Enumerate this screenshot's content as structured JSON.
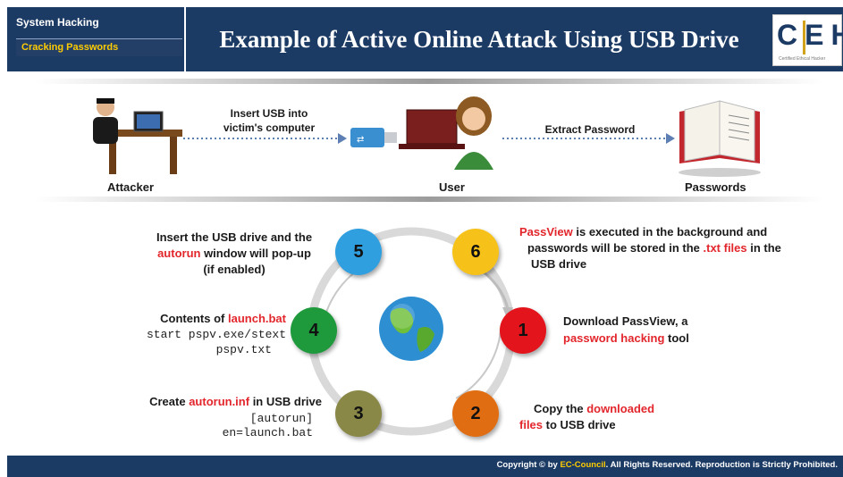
{
  "header": {
    "section": "System Hacking",
    "subsection": "Cracking Passwords",
    "title": "Example of Active Online Attack Using USB Drive",
    "logo": "CEH",
    "logo_small": "Certified Ethical Hacker"
  },
  "flow": {
    "attacker": "Attacker",
    "user": "User",
    "passwords": "Passwords",
    "step_a_line1": "Insert USB into",
    "step_a_line2": "victim's computer",
    "step_b": "Extract Password"
  },
  "cycle": {
    "nums": [
      "1",
      "2",
      "3",
      "4",
      "5",
      "6"
    ],
    "s1_line1": "Download PassView, a",
    "s1_red": "password hacking",
    "s1_rest": " tool",
    "s2_pre": "Copy  the ",
    "s2_red1": "downloaded",
    "s2_red2": "files",
    "s2_rest": " to USB drive",
    "s3_pre": "Create ",
    "s3_red": "autorun.inf",
    "s3_rest": " in USB drive",
    "s3_code1": "[autorun]",
    "s3_code2": "en=launch.bat",
    "s4_pre": "Contents of ",
    "s4_red": "launch.bat",
    "s4_code1": "start pspv.exe/stext",
    "s4_code2": "pspv.txt",
    "s5_line1": "Insert the USB drive and the",
    "s5_red": "autorun",
    "s5_rest": " window will pop-up",
    "s5_line3": "(if enabled)",
    "s6_red1": "PassView",
    "s6_rest1": " is executed in the background and",
    "s6_pre2": "passwords will be stored in the ",
    "s6_red2": ".txt files",
    "s6_rest2": " in the",
    "s6_line3": "USB drive"
  },
  "footer": {
    "pre": "Copyright © by ",
    "brand": "EC-Council",
    "rest": ". All Rights Reserved. Reproduction is Strictly Prohibited."
  },
  "colors": {
    "navy": "#1b3a64",
    "red": "#e2262c",
    "c1": "#e3141b",
    "c2": "#e16d12",
    "c3": "#8a8846",
    "c4": "#1e9a3c",
    "c5": "#2f9fe0",
    "c6": "#f6c21a"
  }
}
